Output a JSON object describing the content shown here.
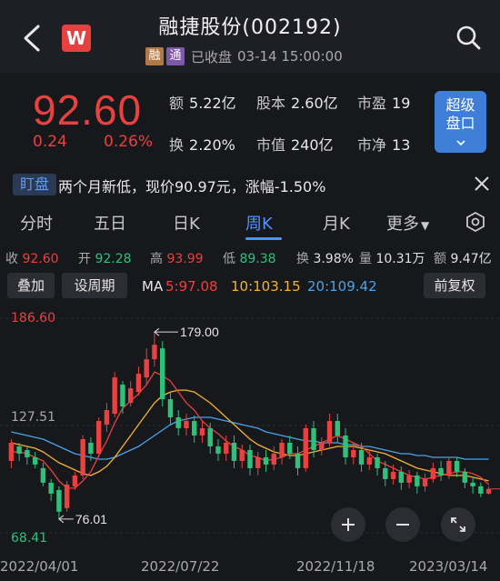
{
  "header": {
    "title": "融捷股份(002192)",
    "logo_text": "W",
    "tag_rong": "融",
    "tag_tong": "通",
    "status": "已收盘",
    "datetime": "03-14 15:00:00"
  },
  "quote": {
    "price": "92.60",
    "change": "0.24",
    "change_pct": "0.26%",
    "fields": [
      {
        "label": "额",
        "value": "5.22亿"
      },
      {
        "label": "股本",
        "value": "2.60亿"
      },
      {
        "label": "市盈",
        "value": "19"
      },
      {
        "label": "换",
        "value": "2.20%"
      },
      {
        "label": "市值",
        "value": "240亿"
      },
      {
        "label": "市净",
        "value": "13"
      }
    ],
    "super_button": [
      "超级",
      "盘口"
    ]
  },
  "news": {
    "tag": "盯盘",
    "text": "两个月新低，现价90.97元，涨幅-1.50%"
  },
  "tabs": [
    "分时",
    "五日",
    "日K",
    "周K",
    "月K",
    "更多"
  ],
  "active_tab": "周K",
  "stats": {
    "close_label": "收",
    "close": "92.60",
    "open_label": "开",
    "open": "92.28",
    "high_label": "高",
    "high": "93.99",
    "low_label": "低",
    "low": "89.38",
    "turnover_label": "换",
    "turnover": "3.98%",
    "volume_label": "量",
    "volume": "10.31万",
    "amount_label": "额",
    "amount": "9.47亿"
  },
  "toolbar": {
    "overlay": "叠加",
    "set_period": "设周期",
    "ma_label": "MA",
    "ma5": "5:97.08",
    "ma10": "10:103.15",
    "ma20": "20:109.42",
    "adjust": "前复权"
  },
  "chart_data": {
    "type": "candlestick",
    "y_top_label": "186.60",
    "y_mid_label": "127.51",
    "y_bottom_label": "68.41",
    "ylim": [
      68.41,
      186.6
    ],
    "max_annotation": "179.00",
    "min_annotation": "76.01",
    "x_labels": [
      "2022/04/01",
      "2022/07/22",
      "2022/11/18",
      "2023/03/14"
    ],
    "candles": [
      {
        "o": 108,
        "c": 118,
        "h": 120,
        "l": 104
      },
      {
        "o": 116,
        "c": 112,
        "h": 118,
        "l": 108
      },
      {
        "o": 114,
        "c": 110,
        "h": 116,
        "l": 106
      },
      {
        "o": 110,
        "c": 106,
        "h": 113,
        "l": 104
      },
      {
        "o": 104,
        "c": 96,
        "h": 107,
        "l": 94
      },
      {
        "o": 96,
        "c": 90,
        "h": 98,
        "l": 86
      },
      {
        "o": 92,
        "c": 80,
        "h": 94,
        "l": 76.01
      },
      {
        "o": 82,
        "c": 95,
        "h": 97,
        "l": 80
      },
      {
        "o": 94,
        "c": 100,
        "h": 102,
        "l": 92
      },
      {
        "o": 100,
        "c": 120,
        "h": 122,
        "l": 98
      },
      {
        "o": 118,
        "c": 112,
        "h": 121,
        "l": 108
      },
      {
        "o": 112,
        "c": 130,
        "h": 132,
        "l": 110
      },
      {
        "o": 128,
        "c": 136,
        "h": 140,
        "l": 124
      },
      {
        "o": 134,
        "c": 154,
        "h": 157,
        "l": 132
      },
      {
        "o": 150,
        "c": 138,
        "h": 152,
        "l": 134
      },
      {
        "o": 140,
        "c": 148,
        "h": 152,
        "l": 138
      },
      {
        "o": 146,
        "c": 156,
        "h": 160,
        "l": 144
      },
      {
        "o": 154,
        "c": 164,
        "h": 170,
        "l": 150
      },
      {
        "o": 164,
        "c": 172,
        "h": 179,
        "l": 160
      },
      {
        "o": 170,
        "c": 142,
        "h": 174,
        "l": 138
      },
      {
        "o": 142,
        "c": 132,
        "h": 146,
        "l": 128
      },
      {
        "o": 132,
        "c": 126,
        "h": 136,
        "l": 122
      },
      {
        "o": 126,
        "c": 130,
        "h": 134,
        "l": 122
      },
      {
        "o": 130,
        "c": 122,
        "h": 133,
        "l": 118
      },
      {
        "o": 122,
        "c": 126,
        "h": 130,
        "l": 118
      },
      {
        "o": 126,
        "c": 116,
        "h": 129,
        "l": 112
      },
      {
        "o": 116,
        "c": 112,
        "h": 120,
        "l": 108
      },
      {
        "o": 112,
        "c": 118,
        "h": 122,
        "l": 108
      },
      {
        "o": 118,
        "c": 108,
        "h": 122,
        "l": 104
      },
      {
        "o": 108,
        "c": 114,
        "h": 117,
        "l": 104
      },
      {
        "o": 114,
        "c": 104,
        "h": 117,
        "l": 100
      },
      {
        "o": 104,
        "c": 110,
        "h": 113,
        "l": 100
      },
      {
        "o": 110,
        "c": 106,
        "h": 114,
        "l": 102
      },
      {
        "o": 106,
        "c": 112,
        "h": 116,
        "l": 103
      },
      {
        "o": 110,
        "c": 118,
        "h": 120,
        "l": 106
      },
      {
        "o": 118,
        "c": 112,
        "h": 122,
        "l": 109
      },
      {
        "o": 112,
        "c": 104,
        "h": 116,
        "l": 100
      },
      {
        "o": 104,
        "c": 126,
        "h": 128,
        "l": 102
      },
      {
        "o": 126,
        "c": 114,
        "h": 130,
        "l": 110
      },
      {
        "o": 114,
        "c": 118,
        "h": 121,
        "l": 111
      },
      {
        "o": 118,
        "c": 130,
        "h": 134,
        "l": 116
      },
      {
        "o": 130,
        "c": 122,
        "h": 134,
        "l": 118
      },
      {
        "o": 122,
        "c": 110,
        "h": 126,
        "l": 106
      },
      {
        "o": 110,
        "c": 114,
        "h": 118,
        "l": 106
      },
      {
        "o": 114,
        "c": 106,
        "h": 118,
        "l": 102
      },
      {
        "o": 106,
        "c": 110,
        "h": 114,
        "l": 103
      },
      {
        "o": 110,
        "c": 104,
        "h": 112,
        "l": 100
      },
      {
        "o": 104,
        "c": 98,
        "h": 108,
        "l": 94
      },
      {
        "o": 98,
        "c": 102,
        "h": 106,
        "l": 95
      },
      {
        "o": 102,
        "c": 96,
        "h": 105,
        "l": 92
      },
      {
        "o": 96,
        "c": 100,
        "h": 103,
        "l": 93
      },
      {
        "o": 100,
        "c": 94,
        "h": 102,
        "l": 90
      },
      {
        "o": 94,
        "c": 98,
        "h": 101,
        "l": 91
      },
      {
        "o": 98,
        "c": 104,
        "h": 107,
        "l": 96
      },
      {
        "o": 104,
        "c": 100,
        "h": 108,
        "l": 97
      },
      {
        "o": 100,
        "c": 108,
        "h": 110,
        "l": 98
      },
      {
        "o": 108,
        "c": 102,
        "h": 110,
        "l": 99
      },
      {
        "o": 102,
        "c": 96,
        "h": 104,
        "l": 93
      },
      {
        "o": 96,
        "c": 94,
        "h": 99,
        "l": 90
      },
      {
        "o": 94,
        "c": 90,
        "h": 96,
        "l": 88
      },
      {
        "o": 90,
        "c": 92.6,
        "h": 93.99,
        "l": 89.38
      }
    ],
    "ma5": [
      113,
      113,
      112,
      110,
      108,
      103,
      97,
      93,
      93,
      97,
      102,
      111,
      119,
      129,
      137,
      141,
      145,
      150,
      157,
      155,
      152,
      146,
      140,
      136,
      130,
      126,
      123,
      119,
      116,
      114,
      111,
      110,
      108,
      109,
      110,
      112,
      112,
      114,
      116,
      118,
      120,
      122,
      120,
      118,
      116,
      112,
      108,
      106,
      104,
      102,
      100,
      99,
      98,
      99,
      100,
      101,
      102,
      102,
      101,
      99,
      95
    ],
    "ma10": [
      118,
      117,
      116,
      115,
      113,
      110,
      107,
      105,
      103,
      101,
      100,
      102,
      105,
      110,
      116,
      122,
      128,
      134,
      140,
      144,
      146,
      147,
      147,
      146,
      143,
      140,
      136,
      132,
      128,
      124,
      120,
      117,
      115,
      113,
      112,
      111,
      111,
      112,
      113,
      114,
      115,
      116,
      116,
      116,
      115,
      114,
      113,
      112,
      110,
      108,
      106,
      104,
      103,
      102,
      101,
      100,
      100,
      100,
      99,
      98,
      97
    ],
    "ma20": [
      124,
      123,
      122,
      121,
      120,
      118,
      116,
      114,
      112,
      111,
      110,
      109,
      109,
      110,
      112,
      114,
      116,
      119,
      122,
      125,
      128,
      130,
      131,
      132,
      132,
      132,
      131,
      130,
      129,
      128,
      127,
      126,
      124,
      123,
      122,
      121,
      120,
      119,
      119,
      118,
      118,
      118,
      117,
      117,
      116,
      116,
      115,
      114,
      113,
      112,
      112,
      111,
      111,
      110,
      110,
      110,
      110,
      109,
      109,
      109,
      109
    ]
  },
  "dates": [
    "2022/04/01",
    "2022/07/22",
    "2022/11/18",
    "2023/03/14"
  ],
  "colors": {
    "up": "#e8413f",
    "down": "#2fc07a",
    "ma5": "#e8413f",
    "ma10": "#f2b233",
    "ma20": "#4aa3e8",
    "accent": "#4e92ff"
  }
}
